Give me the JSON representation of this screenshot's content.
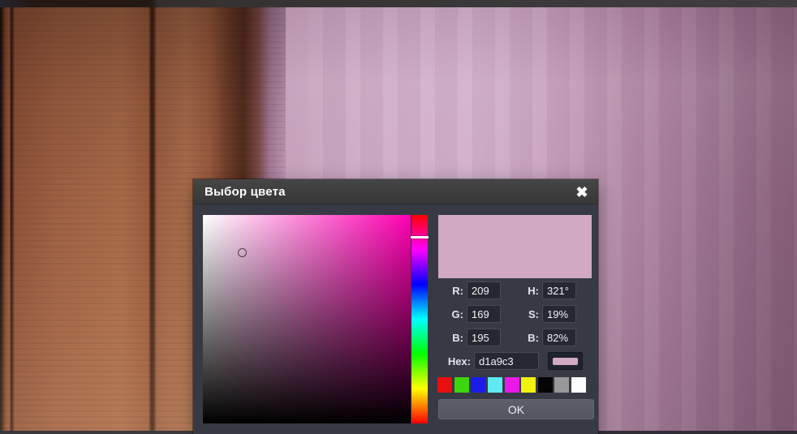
{
  "window": {
    "title": "Выбор цвета",
    "close_icon": "✖"
  },
  "color_picker": {
    "fields": [
      {
        "label": "R:",
        "value": "209"
      },
      {
        "label": "G:",
        "value": "169"
      },
      {
        "label": "B:",
        "value": "195"
      },
      {
        "label": "H:",
        "value": "321°"
      },
      {
        "label": "S:",
        "value": "19%"
      },
      {
        "label": "B:",
        "value": "82%"
      }
    ],
    "hex": {
      "label": "Hex:",
      "value": "d1a9c3"
    },
    "current_color": "#d1a9c3",
    "hue_degrees": 321,
    "palette": [
      "#e90f0f",
      "#3ed60e",
      "#1c1ce8",
      "#5fe9f2",
      "#ea19ea",
      "#f2f20e",
      "#050505",
      "#989898",
      "#fdfdfd"
    ],
    "ok_label": "OK"
  }
}
